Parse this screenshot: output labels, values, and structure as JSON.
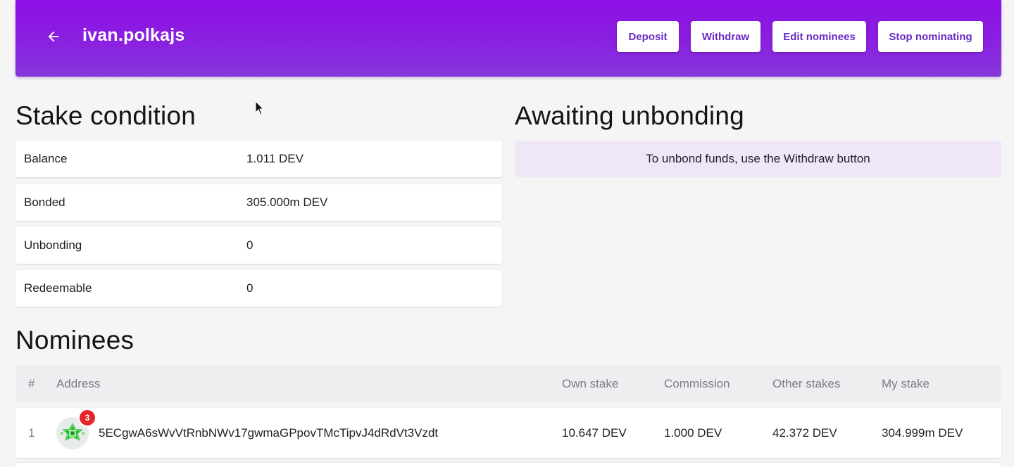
{
  "header": {
    "title": "ivan.polkajs",
    "back_icon": "arrow-left-icon",
    "buttons": {
      "deposit": "Deposit",
      "withdraw": "Withdraw",
      "edit_nominees": "Edit nominees",
      "stop_nominating": "Stop nominating"
    },
    "colors": {
      "gradient_start": "#8e0fe6",
      "gradient_end": "#8538da",
      "button_text": "#6a2bc4"
    }
  },
  "stake_condition": {
    "title": "Stake condition",
    "rows": [
      {
        "label": "Balance",
        "value": "1.011 DEV"
      },
      {
        "label": "Bonded",
        "value": "305.000m DEV"
      },
      {
        "label": "Unbonding",
        "value": "0"
      },
      {
        "label": "Redeemable",
        "value": "0"
      }
    ]
  },
  "awaiting_unbonding": {
    "title": "Awaiting unbonding",
    "message": "To unbond funds, use the Withdraw button",
    "color": "#efe6f8"
  },
  "nominees": {
    "title": "Nominees",
    "columns": {
      "index": "#",
      "address": "Address",
      "own_stake": "Own stake",
      "commission": "Commission",
      "other_stakes": "Other stakes",
      "my_stake": "My stake"
    },
    "rows": [
      {
        "index": "1",
        "badge": "3",
        "address": "5ECgwA6sWvVtRnbNWv17gwmaGPpovTMcTipvJ4dRdVt3Vzdt",
        "own_stake": "10.647 DEV",
        "commission": "1.000 DEV",
        "other_stakes": "42.372 DEV",
        "my_stake": "304.999m DEV"
      }
    ],
    "badge_color": "#e5242b"
  }
}
